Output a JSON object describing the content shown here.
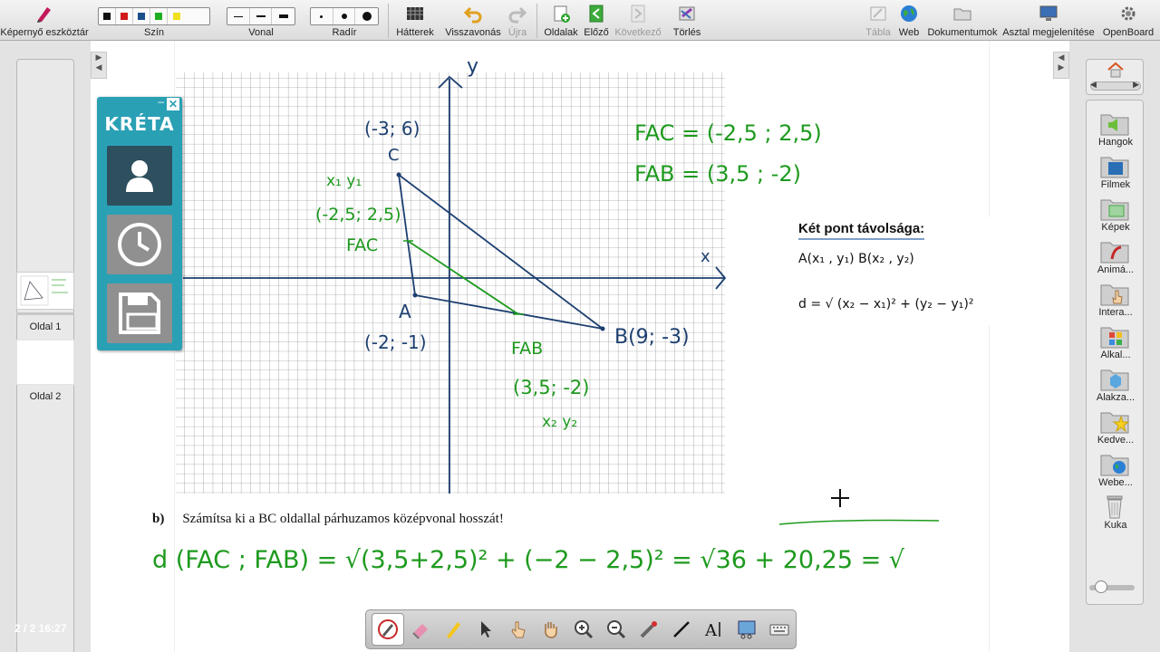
{
  "toolbar": {
    "screen_tools": "Képernyő eszköztár",
    "color": "Szín",
    "line": "Vonal",
    "eraser": "Radír",
    "backgrounds": "Hátterek",
    "undo": "Visszavonás",
    "redo": "Újra",
    "pages": "Oldalak",
    "previous": "Előző",
    "next": "Következő",
    "delete": "Törlés",
    "board": "Tábla",
    "web": "Web",
    "documents": "Dokumentumok",
    "desktop": "Asztal megjelenítése",
    "openboard": "OpenBoard",
    "colors": [
      "#111111",
      "#d11a1a",
      "#1a4f8c",
      "#1fae1f",
      "#f0e020"
    ]
  },
  "pages": {
    "page1_label": "Oldal 1",
    "page2_label": "Oldal 2",
    "counter": "2 / 2 16:27"
  },
  "kreta": {
    "title": "KRÉTA",
    "minimize": "–",
    "close": "✕"
  },
  "graph": {
    "axis_x": "x",
    "axis_y": "y",
    "C_coord": "(-3; 6)",
    "C_label": "C",
    "A_label": "A",
    "A_coord": "(-2; -1)",
    "B_label": "B(9; -3)",
    "x1y1": "x₁ y₁",
    "fac_coord": "(-2,5; 2,5)",
    "fac_label": "FAC",
    "fab_label": "FAB",
    "fab_coord": "(3,5; -2)",
    "x2y2": "x₂   y₂",
    "fac_vector": "FAC = (-2,5 ; 2,5)",
    "fab_vector": "FAB = (3,5 ; -2)"
  },
  "formula": {
    "title": "Két pont távolsága:",
    "points": "A(x₁ , y₁)     B(x₂ , y₂)",
    "equation": "d = √ (x₂ − x₁)² + (y₂ − y₁)²"
  },
  "task": {
    "letter": "b)",
    "text": "Számítsa ki a BC oldallal párhuzamos középvonal hosszát!",
    "handwritten": "d (FAC ; FAB) = √(3,5+2,5)² + (−2 − 2,5)² = √36 + 20,25 = √"
  },
  "library": {
    "sounds": "Hangok",
    "movies": "Filmek",
    "images": "Képek",
    "animations": "Animá...",
    "interactive": "Intera...",
    "applications": "Alkal...",
    "shapes": "Alakza...",
    "favorites": "Kedve...",
    "web": "Webe...",
    "trash": "Kuka"
  }
}
